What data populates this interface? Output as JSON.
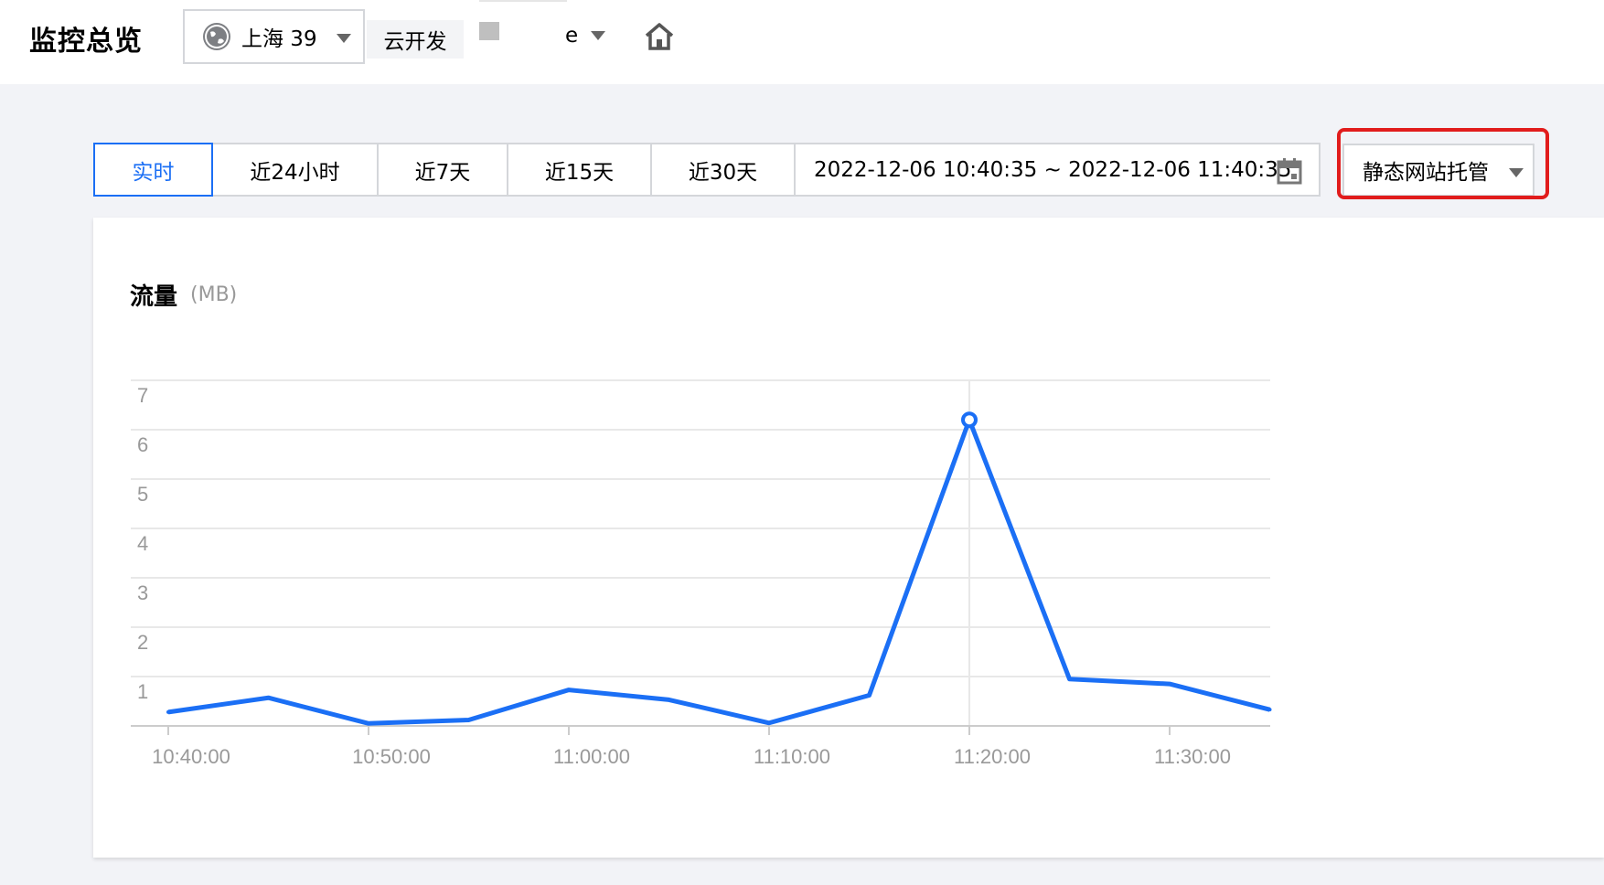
{
  "header": {
    "title": "监控总览",
    "region": "上海 39",
    "env_label": "云开发",
    "env_suffix": "e"
  },
  "time_range": {
    "options": [
      "实时",
      "近24小时",
      "近7天",
      "近15天",
      "近30天"
    ],
    "active": "实时",
    "date_range": "2022-12-06 10:40:35 ~ 2022-12-06 11:40:35"
  },
  "service_select": {
    "value": "静态网站托管"
  },
  "colors": {
    "accent": "#1b6ff5",
    "highlight": "#e11c1c"
  },
  "chart_data": {
    "type": "line",
    "title": "流量",
    "unit": "(MB)",
    "x": [
      "10:40:00",
      "10:45:00",
      "10:50:00",
      "10:55:00",
      "11:00:00",
      "11:05:00",
      "11:10:00",
      "11:15:00",
      "11:20:00",
      "11:25:00",
      "11:30:00",
      "11:35:00"
    ],
    "x_tick_labels": [
      "10:40:00",
      "10:50:00",
      "11:00:00",
      "11:10:00",
      "11:20:00",
      "11:30:00"
    ],
    "values": [
      0.28,
      0.57,
      0.05,
      0.12,
      0.73,
      0.53,
      0.06,
      0.62,
      6.2,
      0.95,
      0.85,
      0.33
    ],
    "ylim": [
      0,
      7
    ],
    "y_ticks": [
      1,
      2,
      3,
      4,
      5,
      6,
      7
    ],
    "highlight_point": "11:20:00",
    "grid": true
  }
}
